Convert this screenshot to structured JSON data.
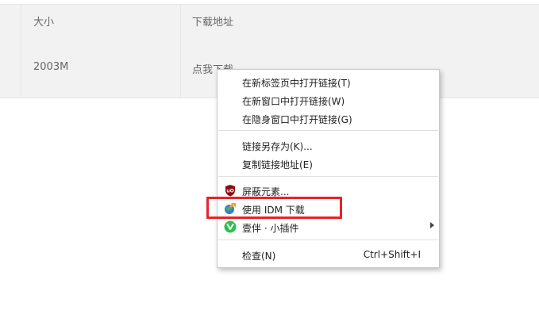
{
  "table": {
    "headers": [
      "大小",
      "下载地址"
    ],
    "rows": [
      {
        "size": "2003M",
        "link": "点我下载"
      }
    ]
  },
  "context_menu": {
    "items": [
      {
        "label": "在新标签页中打开链接(T)"
      },
      {
        "label": "在新窗口中打开链接(W)"
      },
      {
        "label": "在隐身窗口中打开链接(G)"
      },
      {
        "label": "链接另存为(K)..."
      },
      {
        "label": "复制链接地址(E)"
      },
      {
        "label": "屏蔽元素...",
        "icon": "ublock-icon"
      },
      {
        "label": "使用 IDM 下载",
        "icon": "idm-icon"
      },
      {
        "label": "壹伴 · 小插件",
        "icon": "yiban-icon",
        "has_submenu": true
      },
      {
        "label": "检查(N)",
        "shortcut": "Ctrl+Shift+I"
      }
    ]
  },
  "colors": {
    "highlight_border": "#e8232a",
    "ublock_red": "#8b0c0c",
    "yiban_green": "#2fbf4f"
  }
}
